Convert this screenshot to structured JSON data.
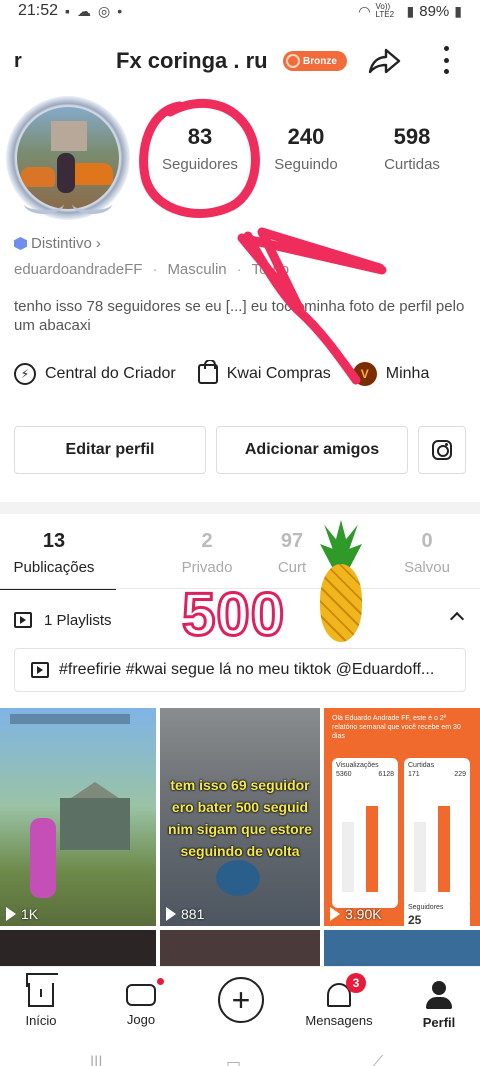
{
  "status_bar": {
    "time": "21:52",
    "network": "Vo)) LTE2",
    "battery": "89%"
  },
  "header": {
    "username_cut": "r",
    "title": "Fx coringa . ru",
    "badge": "Bronze"
  },
  "stats": [
    {
      "value": "83",
      "label": "Seguidores"
    },
    {
      "value": "240",
      "label": "Seguindo"
    },
    {
      "value": "598",
      "label": "Curtidas"
    }
  ],
  "profile": {
    "distinct_label": "Distintivo",
    "handle": "eduardoandradeFF",
    "gender": "Masculin",
    "sign": "Touro",
    "bio": "tenho isso 78 seguidores se eu [...] eu toco minha foto de perfil pelo um abacaxi"
  },
  "links": [
    {
      "label": "Central do Criador",
      "icon": "bolt-icon"
    },
    {
      "label": "Kwai Compras",
      "icon": "bag-icon"
    },
    {
      "label": "Minha",
      "icon": "v-coin-icon"
    }
  ],
  "buttons": {
    "edit": "Editar perfil",
    "add_friends": "Adicionar amigos"
  },
  "tabs": [
    {
      "count": "13",
      "label": "Publicações"
    },
    {
      "count": "2",
      "label": "Privado"
    },
    {
      "count": "97",
      "label": "Curt"
    },
    {
      "count": "0",
      "label": "Salvou"
    }
  ],
  "playlist": {
    "label": "1 Playlists"
  },
  "hashtag_line": "#freefirie #kwai segue lá no meu tiktok @Eduardoff...",
  "videos": [
    {
      "views": "1K"
    },
    {
      "views": "881",
      "caption": [
        "tem isso 69 seguidor",
        "ero bater 500 seguid",
        "nim sigam que estore",
        "seguindo de volta"
      ]
    },
    {
      "views": "3.90K",
      "header": "Olá Eduardo Andrade FF, este é o 2º relatório semanal que você recebe em 30 dias",
      "views_title": "Visualizações",
      "views_a": "5360",
      "views_b": "6128",
      "likes_title": "Curtidas",
      "likes_a": "171",
      "likes_b": "229",
      "followers_title": "Seguidores",
      "followers_value": "25"
    }
  ],
  "overlay": {
    "big_number": "500"
  },
  "bottom_nav": {
    "home": "Início",
    "game": "Jogo",
    "messages": "Mensagens",
    "messages_badge": "3",
    "profile": "Perfil"
  },
  "colors": {
    "accent": "#f26b3a",
    "annotation": "#ef2d5c",
    "badge_red": "#e81c3a"
  }
}
